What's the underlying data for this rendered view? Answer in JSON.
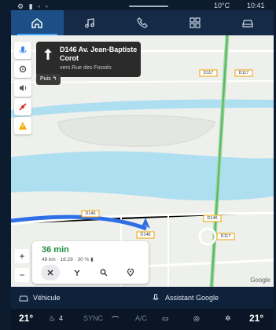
{
  "status_bar": {
    "temperature": "10°C",
    "time": "10:41"
  },
  "nav_tabs": [
    {
      "name": "home",
      "icon": "home-icon",
      "active": true
    },
    {
      "name": "music",
      "icon": "music-icon",
      "active": false
    },
    {
      "name": "phone",
      "icon": "phone-icon",
      "active": false
    },
    {
      "name": "apps",
      "icon": "grid-icon",
      "active": false
    },
    {
      "name": "vehicle",
      "icon": "car-icon",
      "active": false
    }
  ],
  "navigation": {
    "street": "D146 Av. Jean-Baptiste Corot",
    "toward": "vers Rue des Fossés",
    "then_label": "Puis"
  },
  "route": {
    "duration": "36 min",
    "details": "48 km · 16:29 · 30 %"
  },
  "map_labels": {
    "road_1": "D146",
    "road_2": "D146",
    "road_3": "D146",
    "road_4": "D117",
    "road_5": "D117",
    "road_6": "D117",
    "attribution": "Google"
  },
  "zoom": {
    "in": "+",
    "out": "−"
  },
  "bottom_bar": {
    "vehicle_label": "Véhicule",
    "assistant_label": "Assistant Google"
  },
  "climate": {
    "left_temp": "21°",
    "fan_level": "4",
    "sync": "SYNC",
    "ac": "A/C",
    "right_temp": "21°"
  },
  "colors": {
    "accent": "#1d4f86",
    "route": "#2f6fe6",
    "water": "#aedff1",
    "route_eta": "#1e8e3e"
  }
}
